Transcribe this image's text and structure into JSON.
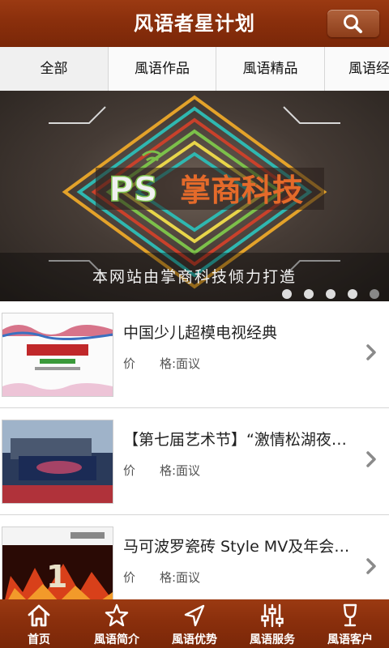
{
  "header": {
    "title": "风语者星计划",
    "search_icon": "search-icon"
  },
  "tabs": [
    {
      "label": "全部",
      "active": true
    },
    {
      "label": "風语作品",
      "active": false
    },
    {
      "label": "風语精品",
      "active": false
    },
    {
      "label": "風语经",
      "active": false
    }
  ],
  "banner": {
    "logo_text": "掌商科技",
    "caption": "本网站由掌商科技倾力打造",
    "slide_count": 5,
    "active_slide": 5
  },
  "products": [
    {
      "name": "中国少儿超模电视经典",
      "price_label": "价　　格:面议"
    },
    {
      "name": "【第七届艺术节】“激情松湖夜…",
      "price_label": "价　　格:面议"
    },
    {
      "name": "马可波罗瓷砖 Style MV及年会…",
      "price_label": "价　　格:面议"
    }
  ],
  "tabbar": [
    {
      "label": "首页",
      "icon": "home-icon"
    },
    {
      "label": "風语简介",
      "icon": "star-icon"
    },
    {
      "label": "風语优势",
      "icon": "navigation-arrow-icon"
    },
    {
      "label": "風语服务",
      "icon": "sliders-icon"
    },
    {
      "label": "風语客户",
      "icon": "wine-glass-icon"
    }
  ],
  "colors": {
    "wood": "#8a2f0c",
    "text": "#222222",
    "muted": "#555555"
  }
}
